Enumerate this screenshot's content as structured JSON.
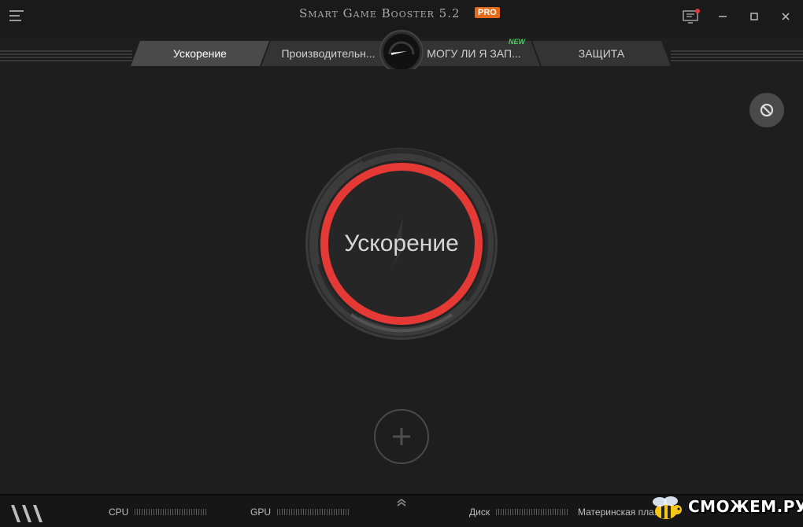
{
  "app": {
    "title": "Smart Game Booster 5.2",
    "badge": "PRO",
    "accent_color": "#e53935",
    "badge_color": "#e36b1a"
  },
  "window_controls": {
    "monitor_icon": "monitor-notification-icon",
    "minimize_icon": "minimize-icon",
    "maximize_icon": "maximize-icon",
    "close_icon": "close-icon"
  },
  "tabs": [
    {
      "label": "Ускорение",
      "active": true
    },
    {
      "label": "Производительн...",
      "active": false
    },
    {
      "label": "МОГУ ЛИ Я ЗАП...",
      "active": false,
      "badge": "NEW"
    },
    {
      "label": "ЗАЩИТА",
      "active": false
    }
  ],
  "main": {
    "boost_button_label": "Ускорение",
    "block_icon": "block-icon",
    "add_icon": "plus-icon"
  },
  "status": {
    "cpu_label": "CPU",
    "gpu_label": "GPU",
    "disk_label": "Диск",
    "mb_label": "Материнская пла..."
  },
  "watermark": {
    "text": "СМОЖЕМ.РУ"
  }
}
